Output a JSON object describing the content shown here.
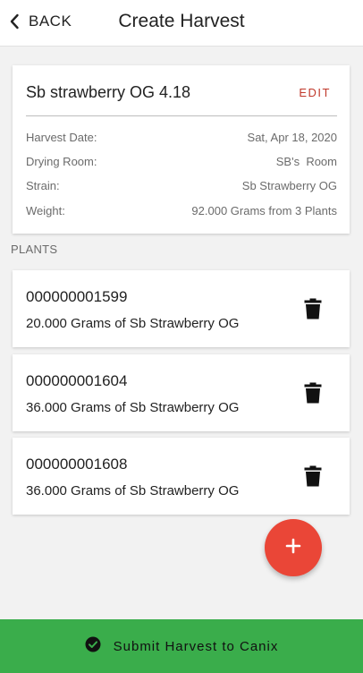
{
  "header": {
    "back_label": "BACK",
    "title": "Create Harvest"
  },
  "summary": {
    "name": "Sb strawberry OG 4.18",
    "edit_label": "EDIT",
    "details": [
      {
        "label": "Harvest Date:",
        "value": "Sat, Apr 18, 2020"
      },
      {
        "label": "Drying Room:",
        "value": "SB's  Room"
      },
      {
        "label": "Strain:",
        "value": "Sb Strawberry OG"
      },
      {
        "label": "Weight:",
        "value": "92.000 Grams from 3 Plants"
      }
    ]
  },
  "plants_section_label": "PLANTS",
  "plants": [
    {
      "id": "000000001599",
      "description": "20.000 Grams of Sb Strawberry OG"
    },
    {
      "id": "000000001604",
      "description": "36.000 Grams of Sb Strawberry OG"
    },
    {
      "id": "000000001608",
      "description": "36.000 Grams of Sb Strawberry OG"
    }
  ],
  "fab_label": "+",
  "submit_label": "Submit Harvest to Canix",
  "colors": {
    "accent_red": "#ea4637",
    "edit_red": "#c0392b",
    "submit_green": "#3aad4b"
  },
  "icons": {
    "back": "chevron-left-icon",
    "delete": "trash-icon",
    "submit": "check-circle-icon",
    "add": "plus-icon"
  }
}
